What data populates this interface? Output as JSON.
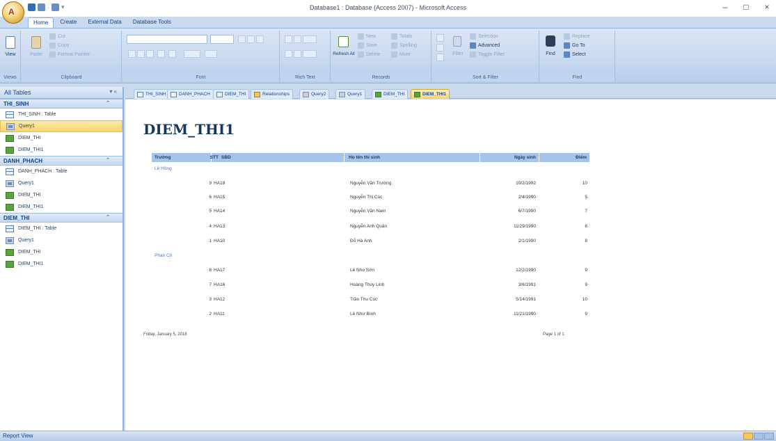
{
  "window": {
    "title": "Database1 : Database (Access 2007) - Microsoft Access",
    "office_button_glyph": "A",
    "controls": {
      "minimize": "–",
      "maximize": "□",
      "close": "×"
    }
  },
  "ribbon": {
    "tabs": [
      "Home",
      "Create",
      "External Data",
      "Database Tools"
    ],
    "active_tab": "Home",
    "groups": {
      "views": {
        "label": "Views",
        "view_label": "View"
      },
      "clipboard": {
        "label": "Clipboard",
        "paste": "Paste",
        "cut": "Cut",
        "copy": "Copy",
        "format_painter": "Format Painter"
      },
      "font": {
        "label": "Font"
      },
      "rich_text": {
        "label": "Rich Text"
      },
      "records": {
        "label": "Records",
        "refresh": "Refresh All",
        "new": "New",
        "save": "Save",
        "delete": "Delete",
        "totals": "Totals",
        "spelling": "Spelling",
        "more": "More"
      },
      "sort_filter": {
        "label": "Sort & Filter",
        "filter": "Filter",
        "selection": "Selection",
        "advanced": "Advanced",
        "toggle_filter": "Toggle Filter"
      },
      "find": {
        "label": "Find",
        "find": "Find",
        "replace": "Replace",
        "goto": "Go To",
        "select": "Select"
      }
    }
  },
  "nav": {
    "header": "All Tables",
    "chevron": "▾ «",
    "groups": [
      {
        "name": "THI_SINH",
        "items": [
          {
            "label": "THI_SINH : Table",
            "type": "table"
          },
          {
            "label": "Query1",
            "type": "query",
            "selected": true
          },
          {
            "label": "DIEM_THI",
            "type": "report"
          },
          {
            "label": "DIEM_THI1",
            "type": "report"
          }
        ]
      },
      {
        "name": "DANH_PHACH",
        "items": [
          {
            "label": "DANH_PHACH : Table",
            "type": "table"
          },
          {
            "label": "Query1",
            "type": "query"
          },
          {
            "label": "DIEM_THI",
            "type": "report"
          },
          {
            "label": "DIEM_THI1",
            "type": "report"
          }
        ]
      },
      {
        "name": "DIEM_THI",
        "items": [
          {
            "label": "DIEM_THI : Table",
            "type": "table"
          },
          {
            "label": "Query1",
            "type": "query"
          },
          {
            "label": "DIEM_THI",
            "type": "report"
          },
          {
            "label": "DIEM_THI1",
            "type": "report"
          }
        ]
      }
    ]
  },
  "doc_tabs": [
    {
      "label": "THI_SINH",
      "type": "table"
    },
    {
      "label": "DANH_PHACH",
      "type": "table"
    },
    {
      "label": "DIEM_THI",
      "type": "table"
    },
    {
      "label": "Relationships",
      "type": "rel"
    },
    {
      "label": "Query2",
      "type": "query"
    },
    {
      "label": "Query1",
      "type": "query"
    },
    {
      "label": "DIEM_THI",
      "type": "report"
    },
    {
      "label": "DIEM_THI1",
      "type": "report",
      "active": true
    }
  ],
  "report": {
    "title": "DIEM_THI1",
    "columns": {
      "truong": "Trường",
      "stt": "STT",
      "sbd": "SBD",
      "hoten": "Họ tên thí sinh",
      "ngaysinh": "Ngày sinh",
      "diem": "Điểm"
    },
    "groups": [
      {
        "school": "Lê Hồng",
        "rows": [
          {
            "stt": "9",
            "sbd": "HA18",
            "name": "Nguyễn Văn Trường",
            "dob": "10/2/1992",
            "score": "10"
          },
          {
            "stt": "6",
            "sbd": "HA15",
            "name": "Nguyễn Thị Cúc",
            "dob": "2/4/1990",
            "score": "5"
          },
          {
            "stt": "5",
            "sbd": "HA14",
            "name": "Nguyễn Văn Nam",
            "dob": "6/7/1990",
            "score": "7"
          },
          {
            "stt": "4",
            "sbd": "HA13",
            "name": "Nguyễn Anh Quân",
            "dob": "11/29/1990",
            "score": "6"
          },
          {
            "stt": "1",
            "sbd": "HA10",
            "name": "Đỗ Hà Anh",
            "dob": "2/1/1990",
            "score": "8"
          }
        ]
      },
      {
        "school": "Phan Ch",
        "rows": [
          {
            "stt": "8",
            "sbd": "HA17",
            "name": "Lê Nho Sơn",
            "dob": "12/2/1990",
            "score": "9"
          },
          {
            "stt": "7",
            "sbd": "HA16",
            "name": "Hoàng Thùy Linh",
            "dob": "3/6/1991",
            "score": "9"
          },
          {
            "stt": "3",
            "sbd": "HA12",
            "name": "Trần Thu Cúc",
            "dob": "5/14/1991",
            "score": "10"
          },
          {
            "stt": "2",
            "sbd": "HA11",
            "name": "Lê Như Bình",
            "dob": "11/21/1990",
            "score": "9"
          }
        ]
      }
    ],
    "footer_date": "Friday, January 5, 2018",
    "footer_page": "Page 1 of 1"
  },
  "status": {
    "text": "Report View"
  }
}
